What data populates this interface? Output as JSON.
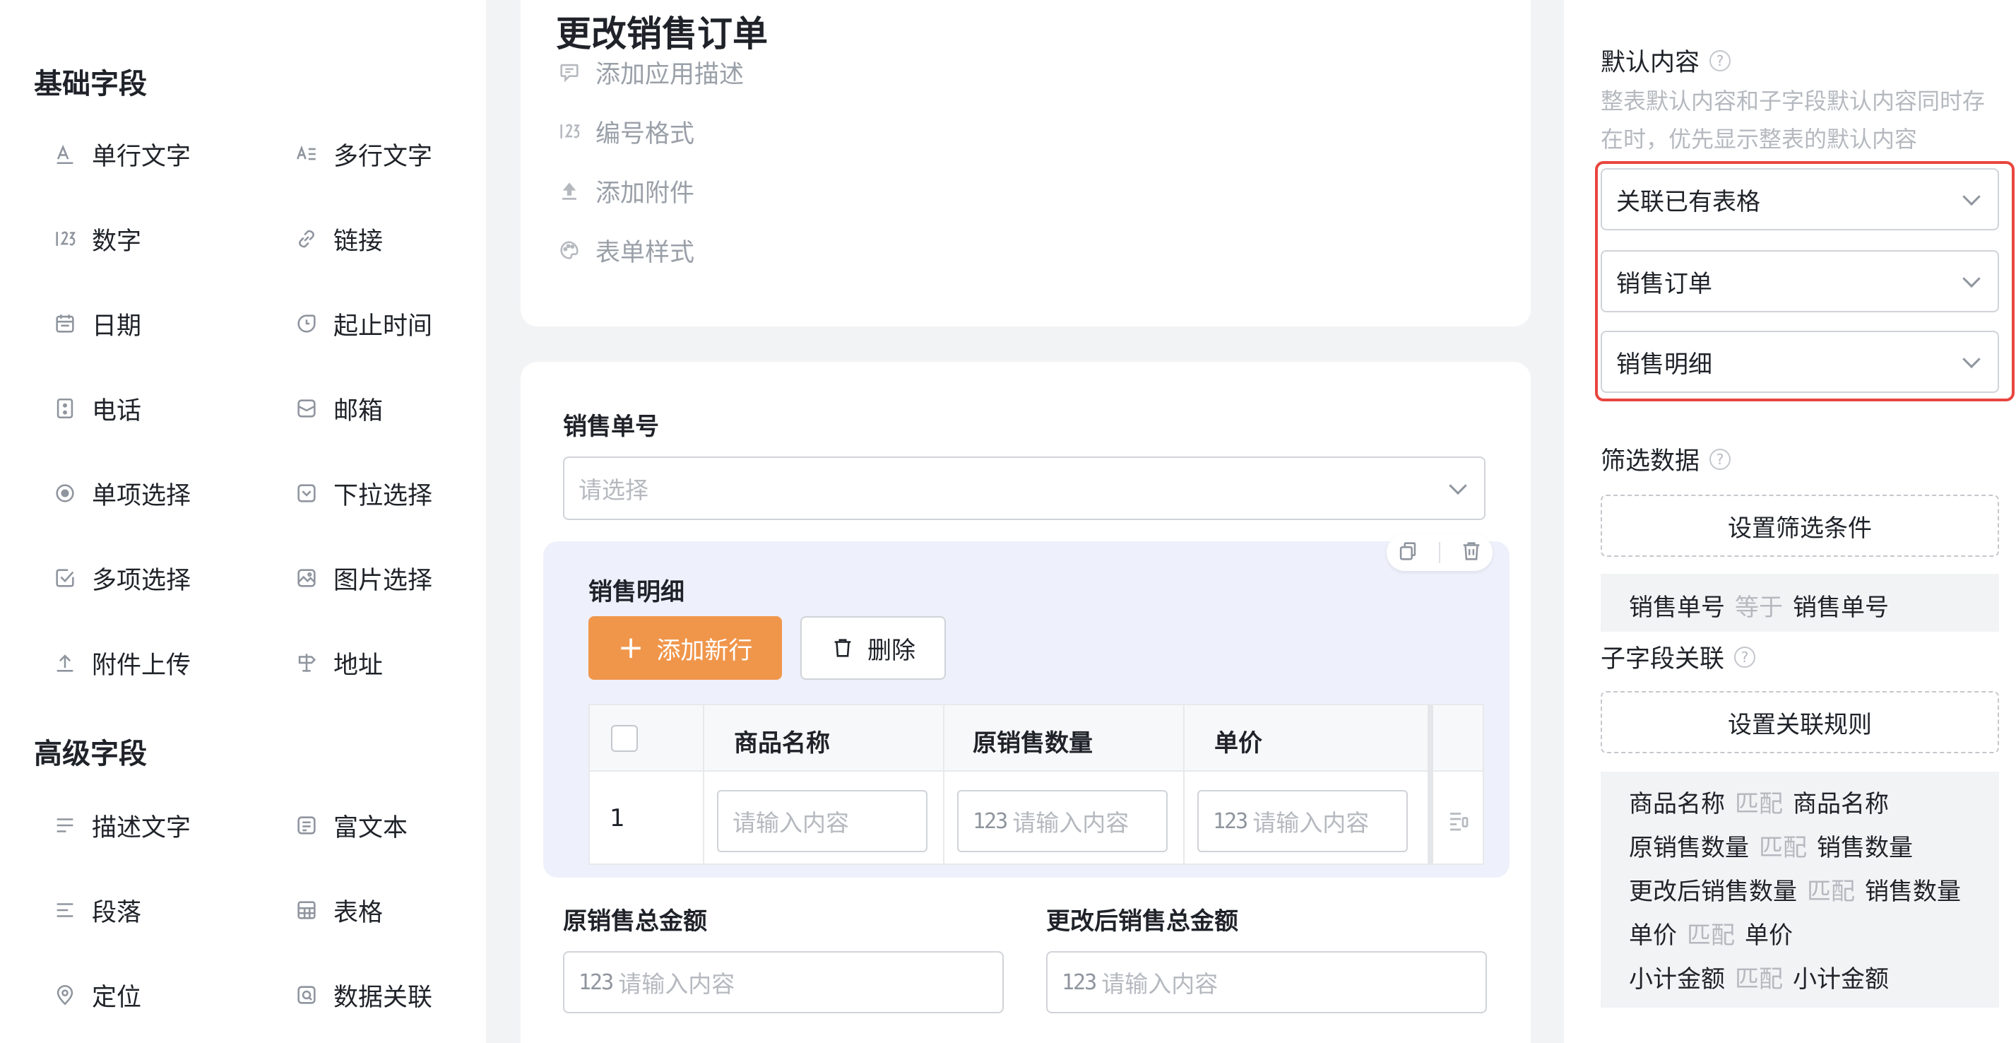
{
  "sidebar": {
    "basic_title": "基础字段",
    "advanced_title": "高级字段",
    "basic_fields": [
      {
        "label": "单行文字",
        "icon": "single-line-text-icon"
      },
      {
        "label": "多行文字",
        "icon": "multi-line-text-icon"
      },
      {
        "label": "数字",
        "icon": "number-icon"
      },
      {
        "label": "链接",
        "icon": "link-icon"
      },
      {
        "label": "日期",
        "icon": "calendar-icon"
      },
      {
        "label": "起止时间",
        "icon": "time-range-icon"
      },
      {
        "label": "电话",
        "icon": "phone-icon"
      },
      {
        "label": "邮箱",
        "icon": "mail-icon"
      },
      {
        "label": "单项选择",
        "icon": "radio-icon"
      },
      {
        "label": "下拉选择",
        "icon": "dropdown-icon"
      },
      {
        "label": "多项选择",
        "icon": "checkbox-icon"
      },
      {
        "label": "图片选择",
        "icon": "image-icon"
      },
      {
        "label": "附件上传",
        "icon": "upload-icon"
      },
      {
        "label": "地址",
        "icon": "address-icon"
      }
    ],
    "advanced_fields": [
      {
        "label": "描述文字",
        "icon": "description-icon"
      },
      {
        "label": "富文本",
        "icon": "rich-text-icon"
      },
      {
        "label": "段落",
        "icon": "paragraph-icon"
      },
      {
        "label": "表格",
        "icon": "table-icon"
      },
      {
        "label": "定位",
        "icon": "location-icon"
      },
      {
        "label": "数据关联",
        "icon": "data-link-icon"
      }
    ]
  },
  "form": {
    "title": "更改销售订单",
    "meta": [
      {
        "label": "添加应用描述",
        "icon": "comment-icon"
      },
      {
        "label": "编号格式",
        "icon": "number-format-icon"
      },
      {
        "label": "添加附件",
        "icon": "attachment-upload-icon"
      },
      {
        "label": "表单样式",
        "icon": "palette-icon"
      }
    ],
    "order_no_label": "销售单号",
    "order_no_placeholder": "请选择",
    "subtable": {
      "title": "销售明细",
      "add_row": "添加新行",
      "delete": "删除",
      "columns": [
        "商品名称",
        "原销售数量",
        "单价"
      ],
      "row_number": "1",
      "cell_placeholder": "请输入内容",
      "num_prefix": "123"
    },
    "total_orig_label": "原销售总金额",
    "total_new_label": "更改后销售总金额",
    "input_placeholder": "请输入内容"
  },
  "panel": {
    "default_title": "默认内容",
    "default_desc": "整表默认内容和子字段默认内容同时存在时，优先显示整表的默认内容",
    "selects": [
      "关联已有表格",
      "销售订单",
      "销售明细"
    ],
    "filter_title": "筛选数据",
    "filter_button": "设置筛选条件",
    "filter_rule": {
      "left": "销售单号",
      "op": "等于",
      "right": "销售单号"
    },
    "subfield_title": "子字段关联",
    "link_button": "设置关联规则",
    "link_rules": [
      {
        "left": "商品名称",
        "op": "匹配",
        "right": "商品名称"
      },
      {
        "left": "原销售数量",
        "op": "匹配",
        "right": "销售数量"
      },
      {
        "left": "更改后销售数量",
        "op": "匹配",
        "right": "销售数量"
      },
      {
        "left": "单价",
        "op": "匹配",
        "right": "单价"
      },
      {
        "left": "小计金额",
        "op": "匹配",
        "right": "小计金额"
      }
    ],
    "highlight_color": "#e8463f"
  },
  "colors": {
    "accent": "#f0964b",
    "subtable_bg": "#eef1fb"
  }
}
